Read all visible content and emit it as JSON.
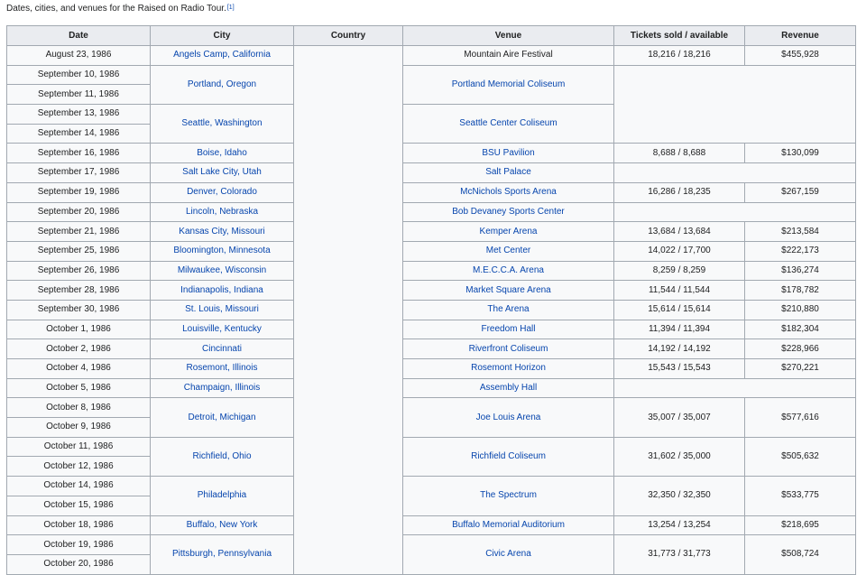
{
  "caption": {
    "text": "Dates, cities, and venues for the Raised on Radio Tour.",
    "ref": "[1]"
  },
  "headers": {
    "date": "Date",
    "city": "City",
    "country": "Country",
    "venue": "Venue",
    "tickets": "Tickets sold / available",
    "revenue": "Revenue"
  },
  "rows": [
    {
      "date": "August 23, 1986",
      "city": "Angels Camp, California",
      "venue": "Mountain Aire Festival",
      "tickets": "18,216 / 18,216",
      "revenue": "$455,928"
    },
    {
      "date": "September 10, 1986",
      "city": "Portland, Oregon",
      "venue": "Portland Memorial Coliseum",
      "tickets": "",
      "revenue": ""
    },
    {
      "date": "September 11, 1986"
    },
    {
      "date": "September 13, 1986",
      "city": "Seattle, Washington",
      "venue": "Seattle Center Coliseum"
    },
    {
      "date": "September 14, 1986"
    },
    {
      "date": "September 16, 1986",
      "city": "Boise, Idaho",
      "venue": "BSU Pavilion",
      "tickets": "8,688 / 8,688",
      "revenue": "$130,099"
    },
    {
      "date": "September 17, 1986",
      "city": "Salt Lake City, Utah",
      "venue": "Salt Palace",
      "tickets": "",
      "revenue": ""
    },
    {
      "date": "September 19, 1986",
      "city": "Denver, Colorado",
      "venue": "McNichols Sports Arena",
      "tickets": "16,286 / 18,235",
      "revenue": "$267,159"
    },
    {
      "date": "September 20, 1986",
      "city": "Lincoln, Nebraska",
      "venue": "Bob Devaney Sports Center",
      "tickets": "",
      "revenue": ""
    },
    {
      "date": "September 21, 1986",
      "city": "Kansas City, Missouri",
      "venue": "Kemper Arena",
      "tickets": "13,684 / 13,684",
      "revenue": "$213,584"
    },
    {
      "date": "September 25, 1986",
      "city": "Bloomington, Minnesota",
      "venue": "Met Center",
      "tickets": "14,022 / 17,700",
      "revenue": "$222,173"
    },
    {
      "date": "September 26, 1986",
      "city": "Milwaukee, Wisconsin",
      "venue": "M.E.C.C.A. Arena",
      "tickets": "8,259 / 8,259",
      "revenue": "$136,274"
    },
    {
      "date": "September 28, 1986",
      "city": "Indianapolis, Indiana",
      "venue": "Market Square Arena",
      "tickets": "11,544 / 11,544",
      "revenue": "$178,782"
    },
    {
      "date": "September 30, 1986",
      "city": "St. Louis, Missouri",
      "venue": "The Arena",
      "tickets": "15,614 / 15,614",
      "revenue": "$210,880"
    },
    {
      "date": "October 1, 1986",
      "city": "Louisville, Kentucky",
      "venue": "Freedom Hall",
      "tickets": "11,394 / 11,394",
      "revenue": "$182,304"
    },
    {
      "date": "October 2, 1986",
      "city": "Cincinnati",
      "venue": "Riverfront Coliseum",
      "tickets": "14,192 / 14,192",
      "revenue": "$228,966"
    },
    {
      "date": "October 4, 1986",
      "city": "Rosemont, Illinois",
      "venue": "Rosemont Horizon",
      "tickets": "15,543 / 15,543",
      "revenue": "$270,221"
    },
    {
      "date": "October 5, 1986",
      "city": "Champaign, Illinois",
      "venue": "Assembly Hall",
      "tickets": "",
      "revenue": ""
    },
    {
      "date": "October 8, 1986",
      "city": "Detroit, Michigan",
      "venue": "Joe Louis Arena",
      "tickets": "35,007 / 35,007",
      "revenue": "$577,616"
    },
    {
      "date": "October 9, 1986"
    },
    {
      "date": "October 11, 1986",
      "city": "Richfield, Ohio",
      "venue": "Richfield Coliseum",
      "tickets": "31,602 / 35,000",
      "revenue": "$505,632"
    },
    {
      "date": "October 12, 1986"
    },
    {
      "date": "October 14, 1986",
      "city": "Philadelphia",
      "venue": "The Spectrum",
      "tickets": "32,350 / 32,350",
      "revenue": "$533,775"
    },
    {
      "date": "October 15, 1986"
    },
    {
      "date": "October 18, 1986",
      "city": "Buffalo, New York",
      "venue": "Buffalo Memorial Auditorium",
      "tickets": "13,254 / 13,254",
      "revenue": "$218,695"
    },
    {
      "date": "October 19, 1986",
      "city": "Pittsburgh, Pennsylvania",
      "venue": "Civic Arena",
      "tickets": "31,773 / 31,773",
      "revenue": "$508,724"
    },
    {
      "date": "October 20, 1986"
    }
  ]
}
